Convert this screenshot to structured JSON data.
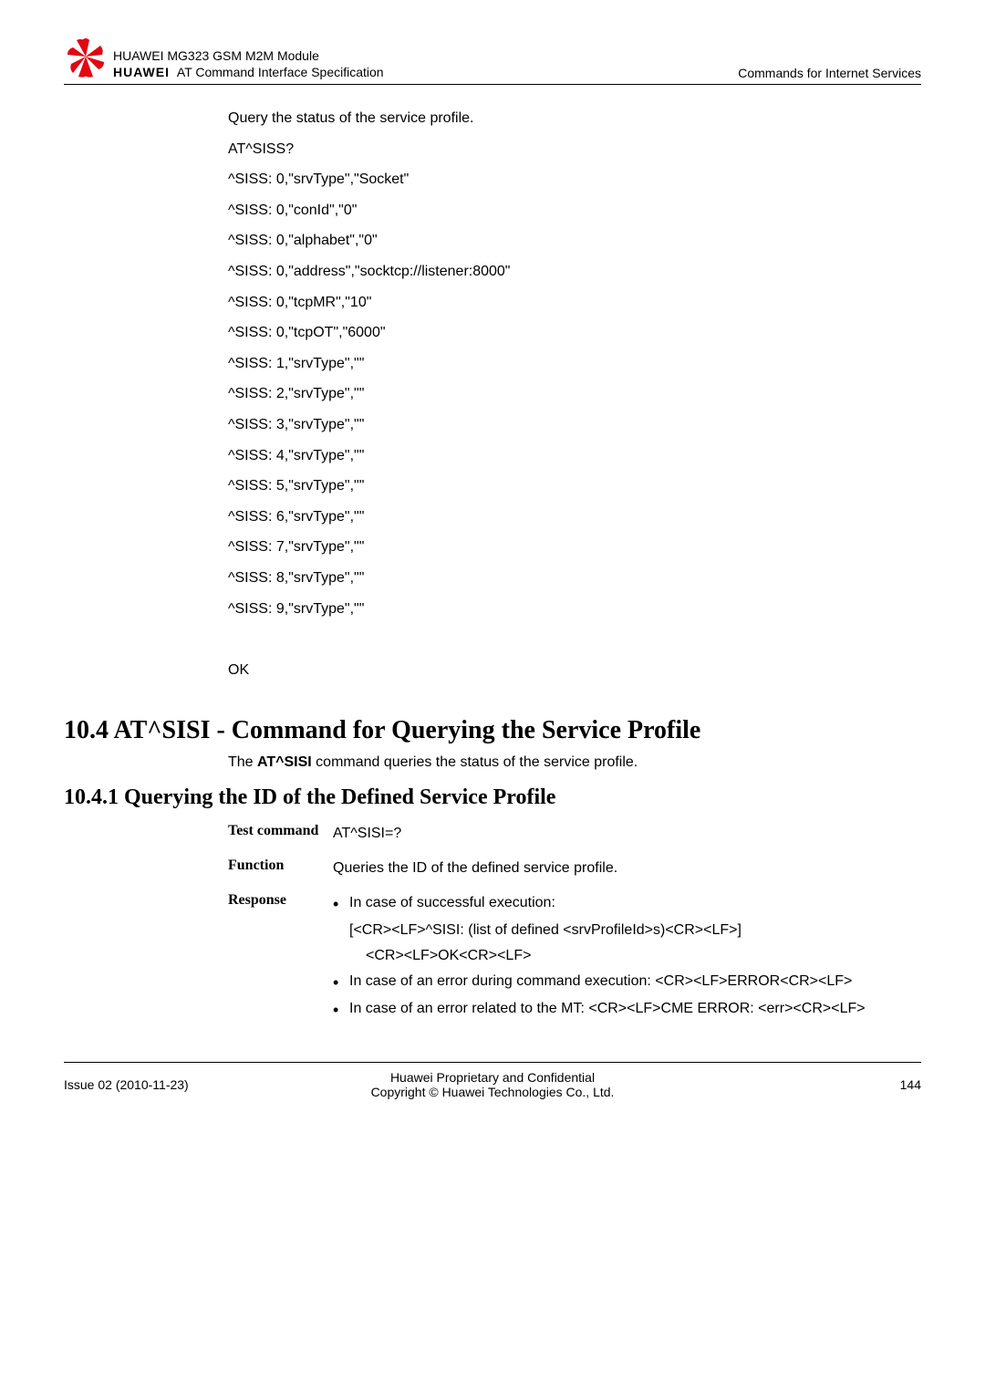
{
  "header": {
    "brand": "HUAWEI",
    "line1": "HUAWEI MG323 GSM M2M Module",
    "line2": "AT Command Interface Specification",
    "right": "Commands for Internet Services"
  },
  "example": {
    "intro": "Query the status of the service profile.",
    "lines": [
      "AT^SISS?",
      "^SISS: 0,\"srvType\",\"Socket\"",
      "^SISS: 0,\"conId\",\"0\"",
      "^SISS: 0,\"alphabet\",\"0\"",
      "^SISS: 0,\"address\",\"socktcp://listener:8000\"",
      "^SISS: 0,\"tcpMR\",\"10\"",
      "^SISS: 0,\"tcpOT\",\"6000\"",
      "^SISS: 1,\"srvType\",\"\"",
      "^SISS: 2,\"srvType\",\"\"",
      "^SISS: 3,\"srvType\",\"\"",
      "^SISS: 4,\"srvType\",\"\"",
      "^SISS: 5,\"srvType\",\"\"",
      "^SISS: 6,\"srvType\",\"\"",
      "^SISS: 7,\"srvType\",\"\"",
      "^SISS: 8,\"srvType\",\"\"",
      "^SISS: 9,\"srvType\",\"\""
    ],
    "blank_ok": "OK"
  },
  "section": {
    "h2": "10.4 AT^SISI - Command for Querying the Service Profile",
    "sub_pre": "The ",
    "sub_bold": "AT^SISI",
    "sub_post": " command queries the status of the service profile.",
    "h3": "10.4.1 Querying the ID of the Defined Service Profile"
  },
  "defs": {
    "test_label": "Test command",
    "test_value": "AT^SISI=?",
    "function_label": "Function",
    "function_value": "Queries the ID of the defined service profile.",
    "response_label": "Response",
    "r1": "In case of successful execution:",
    "r1a": "[<CR><LF>^SISI: (list of defined <srvProfileId>s)<CR><LF>]",
    "r1b": "<CR><LF>OK<CR><LF>",
    "r2": "In case of an error during command execution: <CR><LF>ERROR<CR><LF>",
    "r3": "In case of an error related to the MT: <CR><LF>CME ERROR: <err><CR><LF>"
  },
  "footer": {
    "left": "Issue 02 (2010-11-23)",
    "center1": "Huawei Proprietary and Confidential",
    "center2": "Copyright © Huawei Technologies Co., Ltd.",
    "right": "144"
  }
}
